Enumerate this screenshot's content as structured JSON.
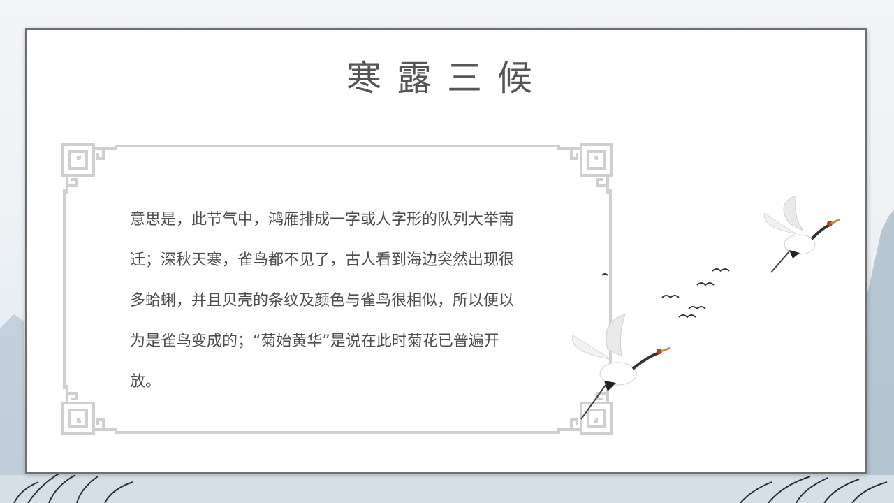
{
  "slide": {
    "title": "寒露三候",
    "body": "意思是，此节气中，鸿雁排成一字或人字形的队列大举南迁；深秋天寒，雀鸟都不见了，古人看到海边突然出现很多蛤蜊，并且贝壳的条纹及颜色与雀鸟很相似，所以便以为是雀鸟变成的；“菊始黄华”是说在此时菊花已普遍开放。"
  },
  "colors": {
    "frame": "#cfcfcf",
    "card_border": "#6f6f6f",
    "title_text": "#555555",
    "body_text": "#4d4d4d"
  },
  "icons": [
    "fret-corner-ornament",
    "red-crowned-crane",
    "flying-bird"
  ]
}
